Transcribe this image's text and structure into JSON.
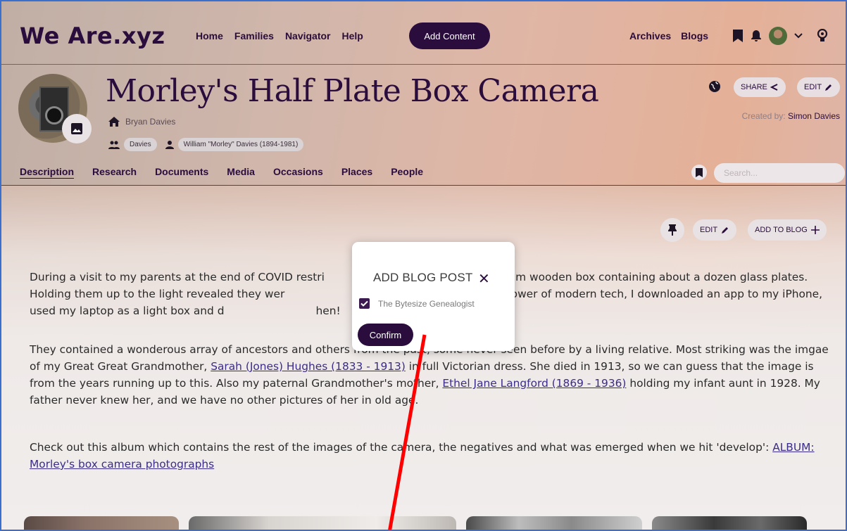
{
  "nav": {
    "logo": "We Are.xyz",
    "links": [
      "Home",
      "Families",
      "Navigator",
      "Help"
    ],
    "add_content": "Add Content",
    "right_links": [
      "Archives",
      "Blogs"
    ]
  },
  "header": {
    "title": "Morley's Half Plate Box Camera",
    "owner": "Bryan Davies",
    "family_tag": "Davies",
    "person_tag": "William \"Morley\" Davies (1894-1981)",
    "share_label": "SHARE",
    "edit_label": "EDIT",
    "created_prefix": "Created by:",
    "created_by": "Simon Davies"
  },
  "tabs": [
    "Description",
    "Research",
    "Documents",
    "Media",
    "Occasions",
    "Places",
    "People"
  ],
  "search": {
    "placeholder": "Search..."
  },
  "content": {
    "edit_label": "EDIT",
    "add_to_blog_label": "ADD TO BLOG",
    "para1_a": "During a visit to my parents at the end of COVID restri",
    "para1_b": "e a slim wooden box containing about a dozen glass plates. Holding them up to the light revealed they wer",
    "para1_c": "vonderous power of modern tech, I downloaded an app to my iPhone, used my laptop as a light box and d",
    "para1_d": "hen!",
    "para2_a": "They contained a wonderous array of ancestors and others from the past, some never seen before by a living relative. Most striking was the imgae of my Great Great Grandmother,",
    "para2_link1": "Sarah (Jones) Hughes (1833 - 1913)",
    "para2_b": "in full Victorian dress. She died in 1913, so we can guess that the image is from the years running up to this. Also my paternal Grandmother's mother,",
    "para2_link2": "Ethel Jane Langford (1869 - 1936)",
    "para2_c": "holding my infant aunt in 1928. My father never knew her, and we have no other pictures of her in old age.",
    "para3_a": "Check out this album which contains the rest of the images of the camera, the negatives and what was emerged when we hit 'develop':",
    "para3_link": "ALBUM: Morley's box camera photographs"
  },
  "modal": {
    "title": "ADD BLOG POST",
    "close": "✕",
    "option": "The Bytesize Genealogist",
    "option_checked": true,
    "confirm": "Confirm"
  },
  "colors": {
    "brand": "#2a0c3d",
    "annotation": "#ff0000"
  }
}
